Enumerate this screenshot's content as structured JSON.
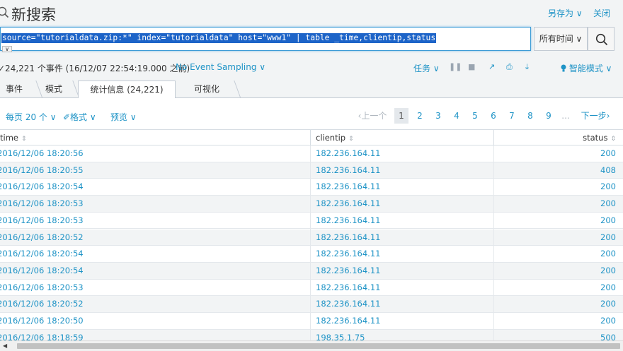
{
  "header": {
    "title": "新搜索",
    "save_as": "另存为 ∨",
    "close": "关闭"
  },
  "search": {
    "query": "source=\"tutorialdata.zip:*\" index=\"tutorialdata\" host=\"www1\" | table _time,clientip,status",
    "expand_glyph": "∨",
    "time_range": "所有时间 ∨"
  },
  "status_bar": {
    "event_count": "✓24,221 个事件 (16/12/07 22:54:19.000 之前)",
    "sampling": "No Event Sampling ∨",
    "jobs": "任务 ∨",
    "pause_glyph": "❚❚",
    "stop_glyph": "■",
    "share_glyph": "↗",
    "print_glyph": "⎙",
    "export_glyph": "⤓",
    "mode": "智能模式 ∨"
  },
  "tabs": [
    {
      "label": "事件"
    },
    {
      "label": "模式"
    },
    {
      "label": "统计信息 (24,221)"
    },
    {
      "label": "可视化"
    }
  ],
  "toolbar": {
    "per_page": "每页 20 个 ∨",
    "format": "✐格式 ∨",
    "preview": "预览 ∨"
  },
  "pagination": {
    "prev": "‹上一个",
    "pages": [
      "1",
      "2",
      "3",
      "4",
      "5",
      "6",
      "7",
      "8",
      "9"
    ],
    "ellipsis": "...",
    "next": "下一步›"
  },
  "table": {
    "columns": [
      "time",
      "clientip",
      "status"
    ],
    "sort_glyph": "⇕",
    "rows": [
      [
        "2016/12/06 18:20:56",
        "182.236.164.11",
        "200"
      ],
      [
        "2016/12/06 18:20:55",
        "182.236.164.11",
        "408"
      ],
      [
        "2016/12/06 18:20:54",
        "182.236.164.11",
        "200"
      ],
      [
        "2016/12/06 18:20:53",
        "182.236.164.11",
        "200"
      ],
      [
        "2016/12/06 18:20:53",
        "182.236.164.11",
        "200"
      ],
      [
        "2016/12/06 18:20:52",
        "182.236.164.11",
        "200"
      ],
      [
        "2016/12/06 18:20:54",
        "182.236.164.11",
        "200"
      ],
      [
        "2016/12/06 18:20:54",
        "182.236.164.11",
        "200"
      ],
      [
        "2016/12/06 18:20:53",
        "182.236.164.11",
        "200"
      ],
      [
        "2016/12/06 18:20:52",
        "182.236.164.11",
        "200"
      ],
      [
        "2016/12/06 18:20:50",
        "182.236.164.11",
        "200"
      ],
      [
        "2016/12/06 18:18:59",
        "198.35.1.75",
        "500"
      ]
    ]
  },
  "colors": {
    "link": "#1e93c6",
    "selection": "#1d64c8",
    "background": "#f2f4f5"
  }
}
